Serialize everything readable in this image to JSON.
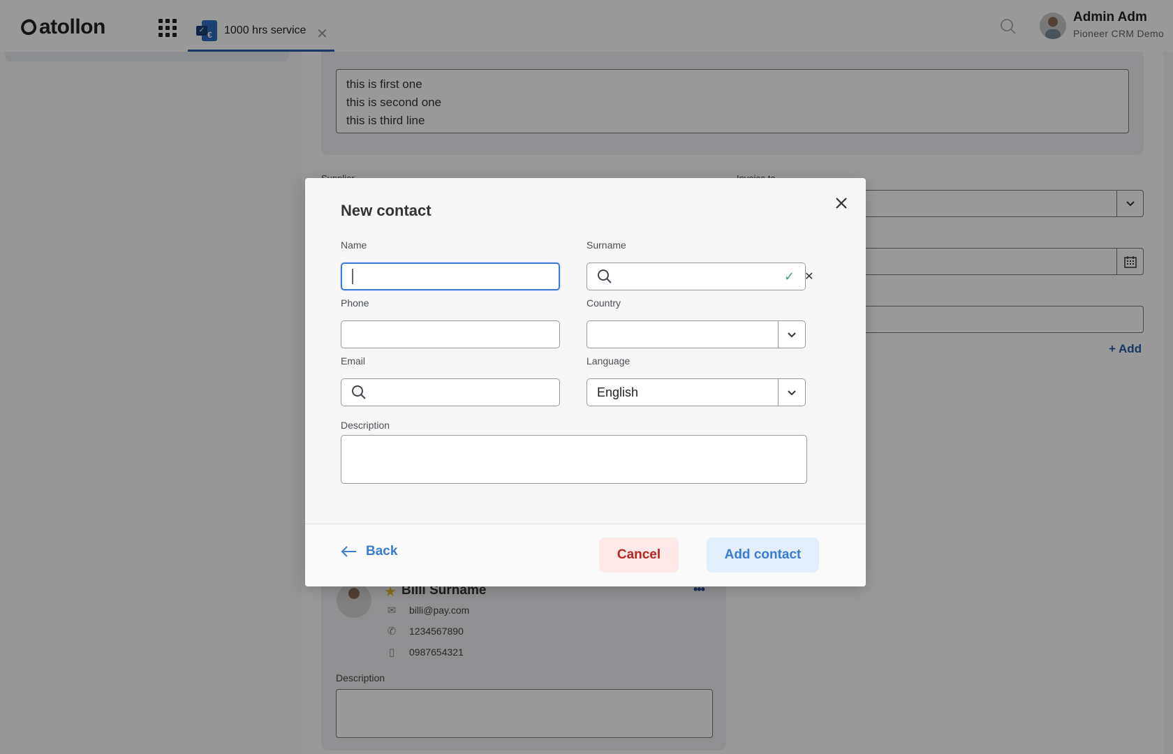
{
  "app": {
    "logo_text": "atollon",
    "tab": {
      "label": "1000 hrs service",
      "icon": "service-invoice-icon"
    },
    "user": {
      "name": "Admin Adm",
      "organization": "Pioneer CRM Demo"
    }
  },
  "background": {
    "notes_lines": [
      "this is first one",
      "this is second one",
      "this is third line"
    ],
    "supplier_label": "Supplier",
    "invoice_to_label": "Invoice to",
    "add_link": "Add",
    "contact_card": {
      "name": "Billi Surname",
      "email": "billi@pay.com",
      "phone": "1234567890",
      "mobile": "0987654321",
      "description_label": "Description"
    }
  },
  "modal": {
    "title": "New contact",
    "fields": {
      "name": {
        "label": "Name",
        "value": ""
      },
      "surname": {
        "label": "Surname",
        "value": ""
      },
      "phone": {
        "label": "Phone",
        "value": ""
      },
      "country": {
        "label": "Country",
        "value": ""
      },
      "email": {
        "label": "Email",
        "value": ""
      },
      "language": {
        "label": "Language",
        "value": "English"
      },
      "description": {
        "label": "Description",
        "value": ""
      }
    },
    "buttons": {
      "back": "Back",
      "cancel": "Cancel",
      "add_contact": "Add contact"
    }
  },
  "colors": {
    "accent": "#3a7bd5",
    "danger": "#b8271e",
    "success": "#3ea36a",
    "tab_underline": "#2a5ca8"
  }
}
